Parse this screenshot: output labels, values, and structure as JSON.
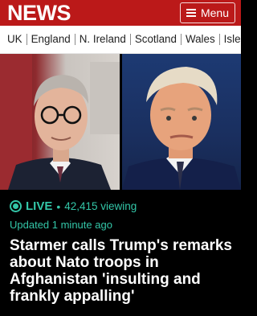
{
  "header": {
    "brand": "NEWS",
    "menu_label": "Menu",
    "brand_color": "#bb1919"
  },
  "nav": {
    "items": [
      "UK",
      "England",
      "N. Ireland",
      "Scotland",
      "Wales",
      "Isle"
    ]
  },
  "photos": [
    {
      "description": "Keir Starmer"
    },
    {
      "description": "Donald Trump"
    }
  ],
  "live": {
    "label": "LIVE",
    "separator": "•",
    "viewing": "42,415 viewing",
    "updated": "Updated 1 minute ago",
    "accent": "#33c6a8"
  },
  "headline": "Starmer calls Trump's remarks about Nato troops in Afghanistan 'insulting and frankly appalling'"
}
